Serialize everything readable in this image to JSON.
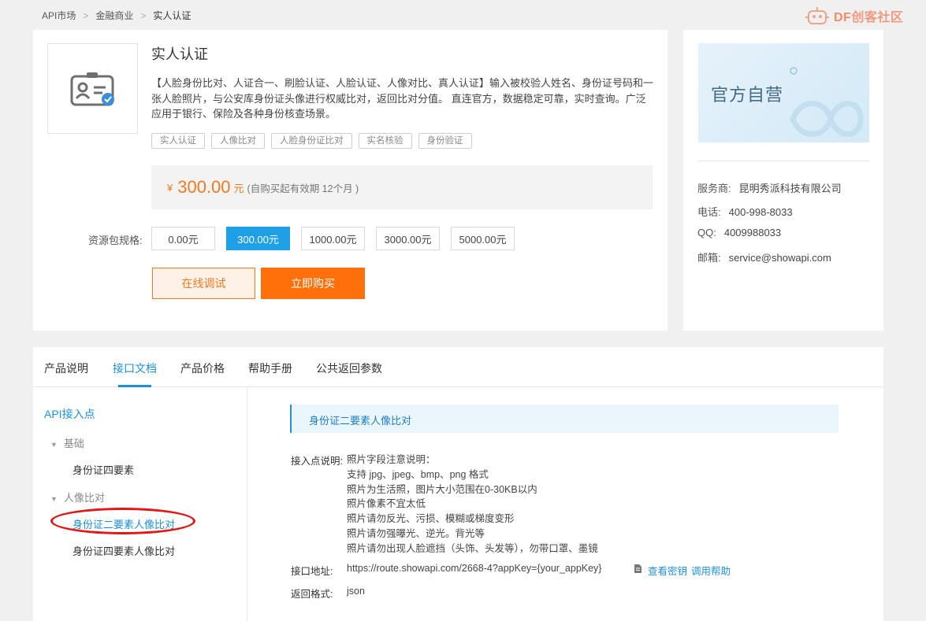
{
  "breadcrumb": {
    "items": [
      "API市场",
      "金融商业",
      "实人认证"
    ],
    "separator": ">"
  },
  "watermark": {
    "df": "DF",
    "text": "创客社区"
  },
  "product": {
    "title": "实人认证",
    "description": "【人脸身份比对、人证合一、刷脸认证、人脸认证、人像对比、真人认证】输入被校验人姓名、身份证号码和一张人脸照片，与公安库身份证头像进行权威比对，返回比对分值。 直连官方，数据稳定可靠，实时查询。广泛应用于银行、保险及各种身份核查场景。",
    "tags": [
      "实人认证",
      "人像比对",
      "人脸身份证比对",
      "实名核验",
      "身份验证"
    ],
    "price": {
      "symbol": "¥",
      "value": "300.00",
      "unit": "元",
      "note": "(自购买起有效期 12个月 )"
    },
    "spec_label": "资源包规格:",
    "specs": [
      "0.00元",
      "300.00元",
      "1000.00元",
      "3000.00元",
      "5000.00元"
    ],
    "spec_selected": "300.00元",
    "test_button": "在线调试",
    "buy_button": "立即购买"
  },
  "side": {
    "banner_text": "官方自营",
    "provider_label": "服务商:",
    "provider": "昆明秀派科技有限公司",
    "phone_label": "电话:",
    "phone": "400-998-8033",
    "qq_label": "QQ:",
    "qq": "4009988033",
    "email_label": "邮箱:",
    "email": "service@showapi.com"
  },
  "tabs": [
    "产品说明",
    "接口文档",
    "产品价格",
    "帮助手册",
    "公共返回参数"
  ],
  "active_tab": "接口文档",
  "nav": {
    "head": "API接入点",
    "group1": "基础",
    "group1_item": "身份证四要素",
    "group2": "人像比对",
    "group2_items": [
      "身份证二要素人像比对",
      "身份证四要素人像比对"
    ],
    "selected": "身份证二要素人像比对"
  },
  "doc": {
    "section_title": "身份证二要素人像比对",
    "desc_label": "接入点说明:",
    "desc_lines": [
      "照片字段注意说明：",
      "支持 jpg、jpeg、bmp、png 格式",
      "照片为生活照，图片大小范围在0-30KB以内",
      "照片像素不宜太低",
      "照片请勿反光、污损、模糊或梯度变形",
      "照片请勿强曝光、逆光。背光等",
      "照片请勿出现人脸遮挡（头饰、头发等），勿带口罩、墨镜"
    ],
    "url_label": "接口地址:",
    "url": "https://route.showapi.com/2668-4?appKey={your_appKey}",
    "link_key": "查看密钥",
    "link_help": "调用帮助",
    "format_label": "返回格式:",
    "format": "json"
  },
  "colors": {
    "accent": "#1e8fd6",
    "orange": "#ff6f0a",
    "price": "#f07a21",
    "annotation": "#e01818"
  }
}
